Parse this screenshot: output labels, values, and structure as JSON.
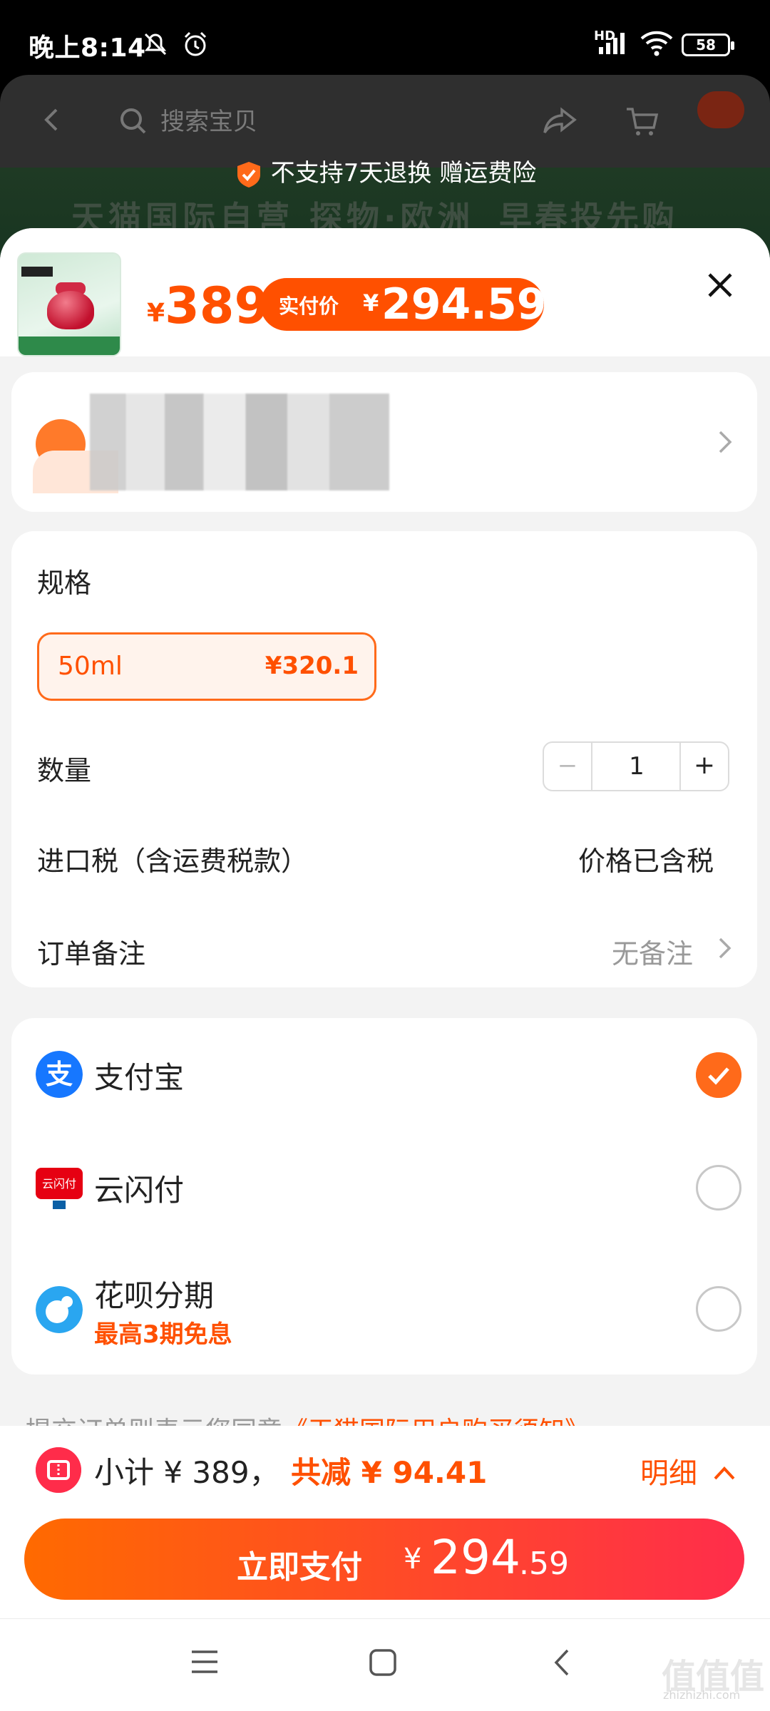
{
  "status_bar": {
    "time": "晚上8:14",
    "network": "HD",
    "battery": "58"
  },
  "background_page": {
    "search_placeholder": "搜索宝贝",
    "notice": "不支持7天退换 赠运费险",
    "banner_left": "天猫国际自营 探物·欧洲",
    "banner_right": "早春投先购"
  },
  "sheet": {
    "price": {
      "currency": "¥",
      "value": "389"
    },
    "final_price": {
      "label": "实付价",
      "currency": "¥",
      "value": "294.59"
    }
  },
  "spec": {
    "label": "规格",
    "option": {
      "name": "50ml",
      "price": "¥320.1"
    }
  },
  "quantity": {
    "label": "数量",
    "minus": "−",
    "value": "1",
    "plus": "+"
  },
  "import_tax": {
    "label": "进口税（含运费税款）",
    "value": "价格已含税"
  },
  "order_note": {
    "label": "订单备注",
    "value": "无备注"
  },
  "payment_methods": [
    {
      "name": "支付宝",
      "selected": true,
      "icon": "alipay-icon",
      "color": "#1677ff"
    },
    {
      "name": "云闪付",
      "selected": false,
      "icon": "unionpay-icon",
      "color": "#e60012"
    },
    {
      "name": "花呗分期",
      "sub": "最高3期免息",
      "selected": false,
      "icon": "huabei-icon",
      "color": "#2aa6f0"
    }
  ],
  "agreement": {
    "prefix": "提交订单则表示您同意",
    "link": "《天猫国际用户购买须知》"
  },
  "summary": {
    "subtotal": "小计 ¥ 389，",
    "discount": "共减 ¥ 94.41",
    "detail": "明细"
  },
  "pay_button": {
    "label": "立即支付",
    "currency": "¥",
    "amount_int": "294",
    "amount_dec": ".59"
  },
  "watermark": {
    "text": "值值值",
    "sub": "zhizhizhi.com"
  },
  "colors": {
    "accent": "#ff5000",
    "pay_gradient_start": "#ff6a00",
    "pay_gradient_end": "#ff2d4b"
  }
}
